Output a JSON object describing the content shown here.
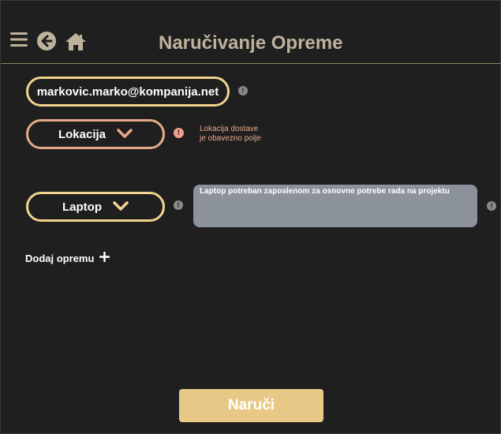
{
  "header": {
    "title": "Naručivanje Opreme",
    "icons": [
      "hamburger-menu-icon",
      "back-arrow-icon",
      "home-icon"
    ]
  },
  "form": {
    "email_value": "markovic.marko@kompanija.net",
    "location_label": "Lokacija",
    "location_error_line1": "Lokacija dostave",
    "location_error_line2": "je obavezno polje",
    "equipment_label": "Laptop",
    "equipment_note": "Laptop potreban zaposlenom za osnovne potrebe rada na projektu",
    "add_equipment_label": "Dodaj opremu",
    "submit_label": "Naruči"
  },
  "colors": {
    "background": "#1f1f1f",
    "title": "#bfb29b",
    "accent": "#f2d38f",
    "error": "#e9a88a",
    "note_bg": "#8c929b",
    "submit_bg": "#e8c887"
  }
}
